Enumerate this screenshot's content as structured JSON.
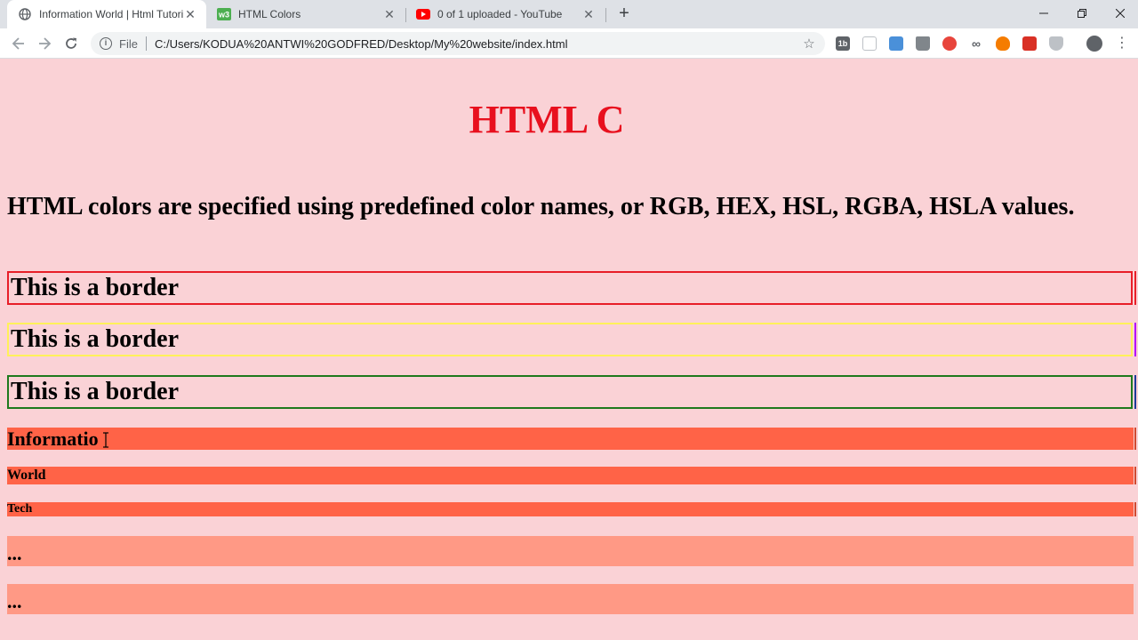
{
  "browser": {
    "tabs": [
      {
        "title": "Information World | Html Tutoria",
        "favicon": "globe-icon",
        "active": true
      },
      {
        "title": "HTML Colors",
        "favicon": "w3schools-icon",
        "active": false
      },
      {
        "title": "0 of 1 uploaded - YouTube",
        "favicon": "youtube-icon",
        "active": false
      }
    ],
    "new_tab_label": "+",
    "address": {
      "scheme": "File",
      "url": "C:/Users/KODUA%20ANTWI%20GODFRED/Desktop/My%20website/index.html"
    },
    "extensions": [
      "ext-1b-icon",
      "ext-page-icon",
      "ext-blue-icon",
      "ext-bag-icon",
      "ext-grammarly-icon",
      "ext-infinity-icon",
      "ext-fire-icon",
      "ext-red-icon",
      "ext-shield-icon"
    ],
    "extension_labels": {
      "first": "1b"
    }
  },
  "content": {
    "heading": "HTML C",
    "intro": "HTML colors are specified using predefined color names, or RGB, HEX, HSL, RGBA, HSLA values.",
    "border_boxes": [
      {
        "label": "This is a border",
        "color": "#e81e28"
      },
      {
        "label": "This is a border",
        "color": "#fff15a"
      },
      {
        "label": "This is a border",
        "color": "#1e7a1e"
      }
    ],
    "bars": [
      {
        "label": "Informatio",
        "color": "#ff6347"
      },
      {
        "label": "World",
        "color": "#ff6347"
      },
      {
        "label": "Tech",
        "color": "#ff6347"
      },
      {
        "label": "...",
        "color": "#ff9985"
      },
      {
        "label": "...",
        "color": "#ff9985"
      }
    ],
    "colors": {
      "page_background": "#fad2d6",
      "heading": "#e8101e"
    }
  }
}
